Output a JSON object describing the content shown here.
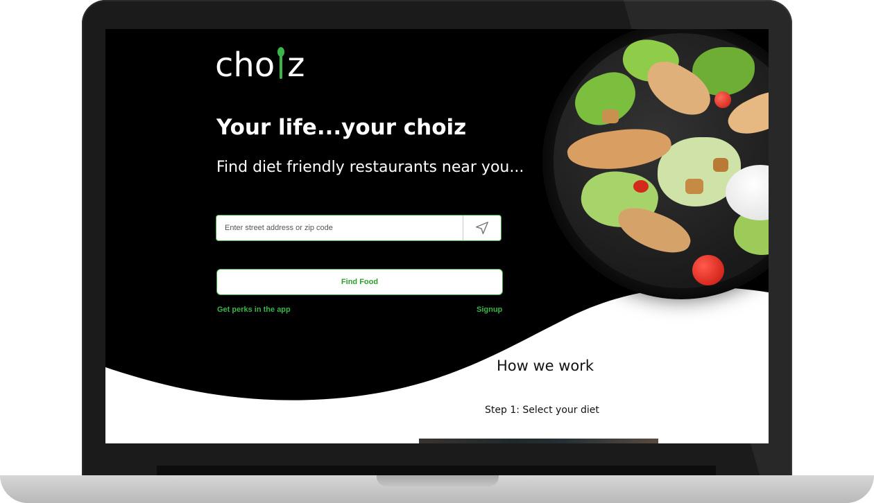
{
  "brand": {
    "logo_prefix": "cho",
    "logo_suffix": "z",
    "accent_color": "#39b54a"
  },
  "hero": {
    "headline": "Your life...your choiz",
    "subhead": "Find diet friendly restaurants near you...",
    "search_placeholder": "Enter street address or zip code",
    "locate_icon": "navigation-arrow-icon",
    "find_button_label": "Find Food",
    "perks_link": "Get perks in the app",
    "signup_link": "Signup"
  },
  "how_we_work": {
    "title": "How we work",
    "step1": "Step 1: Select your diet"
  }
}
